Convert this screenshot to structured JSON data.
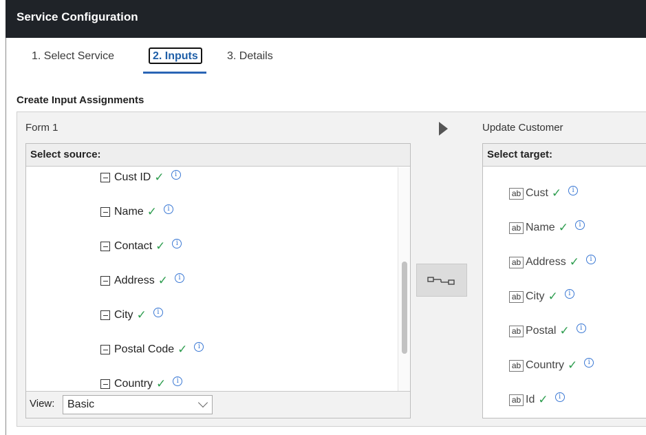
{
  "window": {
    "title": "Service Configuration"
  },
  "tabs": [
    {
      "label": "1. Select Service"
    },
    {
      "label": "2. Inputs",
      "selected": true
    },
    {
      "label": "3. Details"
    }
  ],
  "section": {
    "heading": "Create Input Assignments"
  },
  "source": {
    "form_label": "Form 1",
    "header": "Select source:",
    "items": [
      {
        "label": "Cust ID"
      },
      {
        "label": "Name"
      },
      {
        "label": "Contact"
      },
      {
        "label": "Address"
      },
      {
        "label": "City"
      },
      {
        "label": "Postal Code"
      },
      {
        "label": "Country"
      }
    ],
    "view_label": "View:",
    "view_value": "Basic"
  },
  "target": {
    "form_label": "Update Customer",
    "header": "Select target:",
    "type_badge": "ab",
    "items": [
      {
        "label": "Cust"
      },
      {
        "label": "Name"
      },
      {
        "label": "Address"
      },
      {
        "label": "City"
      },
      {
        "label": "Postal"
      },
      {
        "label": "Country"
      },
      {
        "label": "Id"
      }
    ]
  },
  "icons": {
    "check": "check-icon",
    "info": "info-icon",
    "collapse": "minus-box-icon",
    "map": "map-connector-icon",
    "play": "play-arrow-icon"
  },
  "colors": {
    "title_bar_bg": "#1f2328",
    "active_tab": "#1f5fa8",
    "check": "#2e9d4f",
    "info": "#3a78d4"
  }
}
